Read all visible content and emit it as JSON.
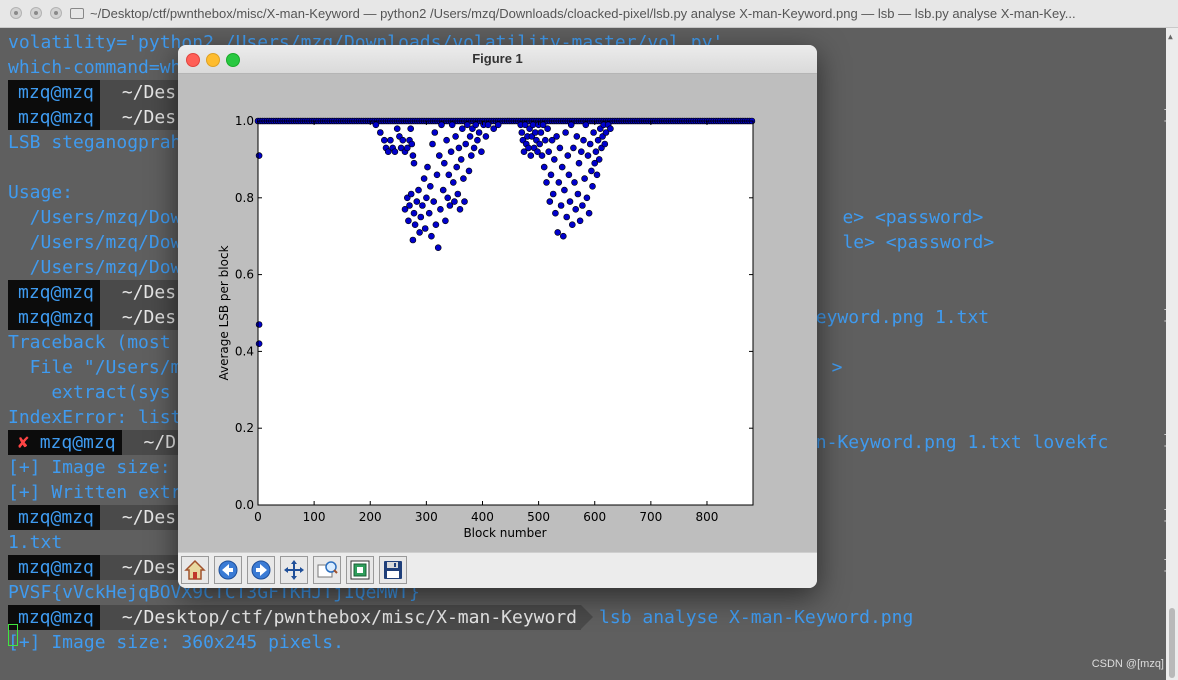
{
  "terminal": {
    "window_title": "~/Desktop/ctf/pwnthebox/misc/X-man-Keyword — python2 /Users/mzq/Downloads/cloacked-pixel/lsb.py analyse X-man-Keyword.png — lsb — lsb.py analyse X-man-Key...",
    "lines": [
      {
        "text": "volatility='python2 /Users/mzq/Downloads/volatility-master/vol.py'"
      },
      {
        "text": "which-command=wh"
      },
      {
        "text": "LSB steganogprah"
      },
      {
        "text": "Usage:"
      },
      {
        "text": "  /Users/mzq/Dow                                                             e> <password>"
      },
      {
        "text": "  /Users/mzq/Dow                                                             le> <password>"
      },
      {
        "text": "  /Users/mzq/Dow"
      },
      {
        "text": "Traceback (most"
      },
      {
        "text": "  File \"/Users/m                                                            >"
      },
      {
        "text": "    extract(sys"
      },
      {
        "text": "IndexError: list"
      },
      {
        "text": "[+] Image size:"
      },
      {
        "text": "[+] Written extr"
      },
      {
        "text": "1.txt"
      },
      {
        "text": "PVSF{vVckHejqBOVX9CTCT3GFTKHJTjIQeMWT}"
      },
      {
        "text": "[+] Image size: 360x245 pixels."
      }
    ],
    "prompts": [
      {
        "user": "mzq@mzq",
        "path": "~/Des",
        "cmd": ""
      },
      {
        "user": "mzq@mzq",
        "path": "~/Des",
        "cmd": ""
      },
      {
        "user": "mzq@mzq",
        "path": "~/Des",
        "cmd": ""
      },
      {
        "user": "mzq@mzq",
        "path": "~/Des",
        "cmd": "                                                      n-Keyword.png 1.txt"
      },
      {
        "user": "mzq@mzq",
        "path": "~/D",
        "cmd": "                                                        an-Keyword.png 1.txt lovekfc",
        "error_mark": "✘"
      },
      {
        "user": "mzq@mzq",
        "path": "~/Des",
        "cmd": ""
      },
      {
        "user": "mzq@mzq",
        "path": "~/Des",
        "cmd": ""
      },
      {
        "user": "mzq@mzq",
        "path": "~/Desktop/ctf/pwnthebox/misc/X-man-Keyword",
        "cmd": "lsb analyse X-man-Keyword.png"
      }
    ],
    "watermark": "CSDN @[mzq]"
  },
  "figure": {
    "window_title": "Figure 1",
    "toolbar_icons": [
      "home-icon",
      "back-arrow-icon",
      "forward-arrow-icon",
      "pan-move-icon",
      "zoom-rect-icon",
      "subplots-config-icon",
      "save-floppy-icon"
    ]
  },
  "chart_data": {
    "type": "scatter",
    "xlabel": "Block number",
    "ylabel": "Average LSB per block",
    "xlim": [
      0,
      882
    ],
    "ylim": [
      0,
      1
    ],
    "xticks": [
      "0",
      "100",
      "200",
      "300",
      "400",
      "500",
      "600",
      "700",
      "800"
    ],
    "yticks": [
      "0.0",
      "0.2",
      "0.4",
      "0.6",
      "0.8",
      "1.0"
    ],
    "grid": false,
    "marker_color": "#0000cc",
    "note_series": "dense line of points at y=1.0 across x 0–882 plus two clusters below",
    "points": [
      [
        2,
        0.91
      ],
      [
        2,
        0.47
      ],
      [
        2,
        0.42
      ],
      [
        210,
        0.99
      ],
      [
        218,
        0.97
      ],
      [
        225,
        0.95
      ],
      [
        228,
        0.93
      ],
      [
        232,
        0.92
      ],
      [
        236,
        0.95
      ],
      [
        240,
        0.93
      ],
      [
        244,
        0.92
      ],
      [
        248,
        0.98
      ],
      [
        252,
        0.96
      ],
      [
        255,
        0.93
      ],
      [
        258,
        0.95
      ],
      [
        262,
        0.92
      ],
      [
        266,
        0.93
      ],
      [
        270,
        0.95
      ],
      [
        272,
        0.98
      ],
      [
        274,
        0.94
      ],
      [
        276,
        0.91
      ],
      [
        278,
        0.89
      ],
      [
        262,
        0.77
      ],
      [
        266,
        0.8
      ],
      [
        268,
        0.74
      ],
      [
        270,
        0.78
      ],
      [
        273,
        0.81
      ],
      [
        276,
        0.69
      ],
      [
        278,
        0.76
      ],
      [
        280,
        0.73
      ],
      [
        283,
        0.79
      ],
      [
        286,
        0.82
      ],
      [
        288,
        0.71
      ],
      [
        290,
        0.75
      ],
      [
        293,
        0.78
      ],
      [
        296,
        0.85
      ],
      [
        298,
        0.72
      ],
      [
        300,
        0.8
      ],
      [
        302,
        0.88
      ],
      [
        305,
        0.76
      ],
      [
        307,
        0.83
      ],
      [
        309,
        0.7
      ],
      [
        311,
        0.94
      ],
      [
        313,
        0.79
      ],
      [
        315,
        0.97
      ],
      [
        317,
        0.73
      ],
      [
        319,
        0.86
      ],
      [
        321,
        0.67
      ],
      [
        323,
        0.91
      ],
      [
        325,
        0.77
      ],
      [
        327,
        0.99
      ],
      [
        330,
        0.82
      ],
      [
        332,
        0.89
      ],
      [
        334,
        0.74
      ],
      [
        336,
        0.95
      ],
      [
        338,
        0.8
      ],
      [
        340,
        0.86
      ],
      [
        342,
        0.78
      ],
      [
        344,
        0.92
      ],
      [
        346,
        0.99
      ],
      [
        348,
        0.84
      ],
      [
        350,
        0.79
      ],
      [
        352,
        0.96
      ],
      [
        354,
        0.88
      ],
      [
        356,
        0.81
      ],
      [
        358,
        0.93
      ],
      [
        360,
        0.77
      ],
      [
        362,
        0.9
      ],
      [
        364,
        0.98
      ],
      [
        366,
        0.85
      ],
      [
        368,
        0.79
      ],
      [
        370,
        0.94
      ],
      [
        373,
        0.99
      ],
      [
        376,
        0.87
      ],
      [
        378,
        0.96
      ],
      [
        380,
        0.91
      ],
      [
        382,
        0.98
      ],
      [
        385,
        0.93
      ],
      [
        388,
        0.99
      ],
      [
        391,
        0.95
      ],
      [
        394,
        0.97
      ],
      [
        398,
        0.92
      ],
      [
        402,
        0.99
      ],
      [
        406,
        0.96
      ],
      [
        410,
        0.99
      ],
      [
        420,
        0.98
      ],
      [
        428,
        0.99
      ],
      [
        468,
        0.99
      ],
      [
        470,
        0.97
      ],
      [
        472,
        0.95
      ],
      [
        474,
        0.92
      ],
      [
        476,
        0.99
      ],
      [
        478,
        0.94
      ],
      [
        480,
        0.96
      ],
      [
        482,
        0.93
      ],
      [
        484,
        0.98
      ],
      [
        486,
        0.91
      ],
      [
        488,
        0.96
      ],
      [
        490,
        0.99
      ],
      [
        492,
        0.93
      ],
      [
        494,
        0.97
      ],
      [
        496,
        0.95
      ],
      [
        498,
        0.92
      ],
      [
        500,
        0.99
      ],
      [
        502,
        0.94
      ],
      [
        504,
        0.97
      ],
      [
        506,
        0.91
      ],
      [
        508,
        0.99
      ],
      [
        510,
        0.88
      ],
      [
        512,
        0.95
      ],
      [
        514,
        0.84
      ],
      [
        516,
        0.98
      ],
      [
        518,
        0.92
      ],
      [
        520,
        0.79
      ],
      [
        522,
        0.86
      ],
      [
        524,
        0.95
      ],
      [
        526,
        0.81
      ],
      [
        528,
        0.9
      ],
      [
        530,
        0.76
      ],
      [
        532,
        0.96
      ],
      [
        534,
        0.71
      ],
      [
        536,
        0.84
      ],
      [
        538,
        0.93
      ],
      [
        540,
        0.78
      ],
      [
        542,
        0.88
      ],
      [
        544,
        0.7
      ],
      [
        546,
        0.82
      ],
      [
        548,
        0.97
      ],
      [
        550,
        0.75
      ],
      [
        552,
        0.91
      ],
      [
        554,
        0.86
      ],
      [
        556,
        0.79
      ],
      [
        558,
        0.99
      ],
      [
        560,
        0.73
      ],
      [
        562,
        0.93
      ],
      [
        564,
        0.84
      ],
      [
        566,
        0.77
      ],
      [
        568,
        0.96
      ],
      [
        570,
        0.81
      ],
      [
        572,
        0.89
      ],
      [
        574,
        0.74
      ],
      [
        576,
        0.92
      ],
      [
        578,
        0.78
      ],
      [
        580,
        0.95
      ],
      [
        582,
        0.85
      ],
      [
        584,
        0.99
      ],
      [
        586,
        0.8
      ],
      [
        588,
        0.91
      ],
      [
        590,
        0.76
      ],
      [
        592,
        0.94
      ],
      [
        594,
        0.87
      ],
      [
        596,
        0.83
      ],
      [
        598,
        0.97
      ],
      [
        600,
        0.89
      ],
      [
        602,
        0.92
      ],
      [
        604,
        0.86
      ],
      [
        606,
        0.95
      ],
      [
        608,
        0.9
      ],
      [
        610,
        0.98
      ],
      [
        612,
        0.93
      ],
      [
        614,
        0.96
      ],
      [
        616,
        0.99
      ],
      [
        618,
        0.94
      ],
      [
        620,
        0.97
      ],
      [
        624,
        0.99
      ],
      [
        628,
        0.98
      ]
    ]
  }
}
